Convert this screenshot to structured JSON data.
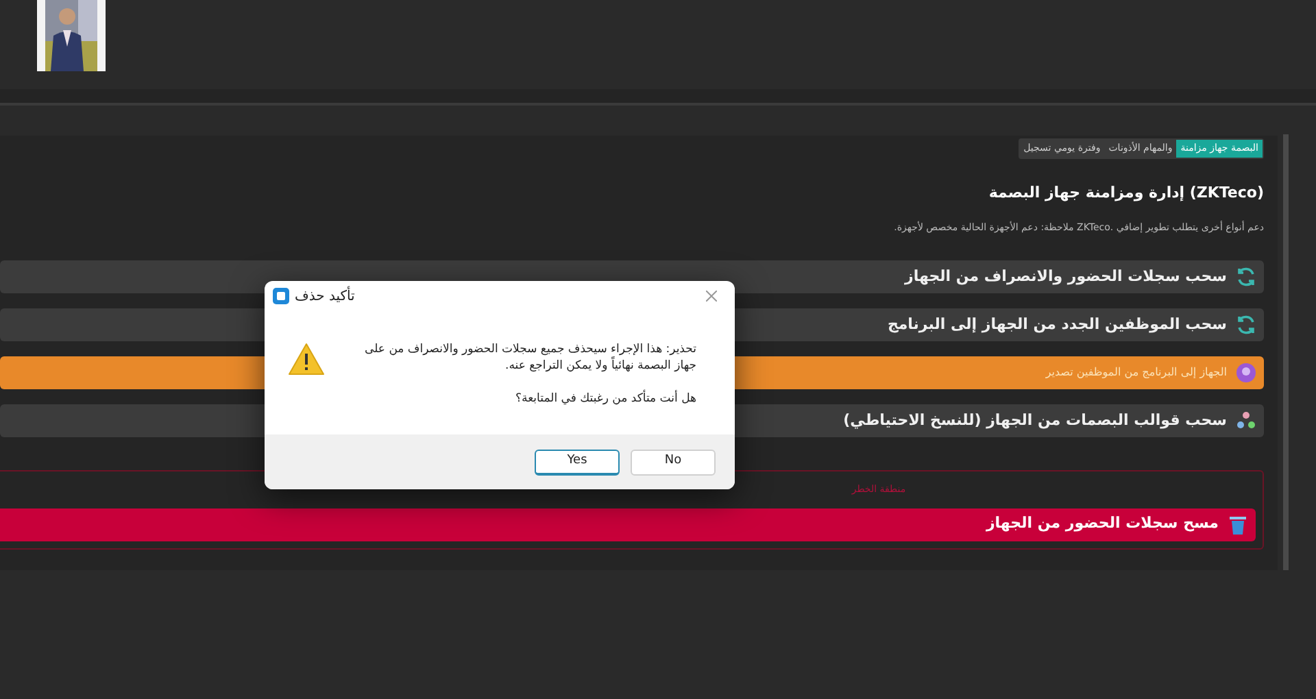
{
  "tabs": [
    {
      "label": "البصمة جهاز مزامنة",
      "selected": true
    },
    {
      "label": "والمهام الأذونات",
      "selected": false
    },
    {
      "label": "وفترة يومي تسجيل",
      "selected": false
    }
  ],
  "section": {
    "title": "(ZKTeco) إدارة ومزامنة جهاز البصمة",
    "note": "دعم أنواع أخرى يتطلب تطوير إضافي .ZKTeco ملاحظة: دعم الأجهزة الحالية مخصص لأجهزة."
  },
  "actions": [
    {
      "label": "سحب سجلات الحضور والانصراف من الجهاز",
      "kind": "sync",
      "color": "#3c3c3c"
    },
    {
      "label": "سحب الموظفين الجدد من الجهاز إلى البرنامج",
      "kind": "sync",
      "color": "#3c3c3c"
    },
    {
      "label": "الجهاز إلى البرنامج من الموظفين تصدير",
      "kind": "export",
      "color": "#e8892a"
    },
    {
      "label": "سحب قوالب البصمات من الجهاز (للنسخ الاحتياطي)",
      "kind": "templates",
      "color": "#3c3c3c"
    }
  ],
  "danger_zone": {
    "title": "منطقة الخطر",
    "action": {
      "label": "مسح سجلات الحضور من الجهاز",
      "kind": "delete"
    }
  },
  "dialog": {
    "title": "تأكيد حذف",
    "message": "تحذير: هذا الإجراء سيحذف جميع سجلات الحضور والانصراف من على جهاز البصمة نهائياً ولا يمكن التراجع عنه.",
    "question": "هل أنت متأكد من رغبتك في المتابعة؟",
    "buttons": [
      {
        "label": "No",
        "selected": false
      },
      {
        "label": "Yes",
        "selected": true
      }
    ]
  }
}
